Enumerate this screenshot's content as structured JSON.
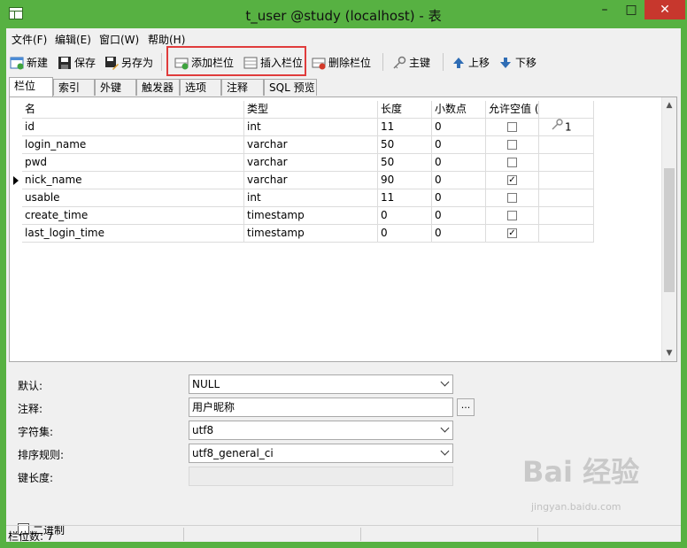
{
  "window": {
    "title": "t_user @study (localhost) - 表",
    "min_glyph": "–",
    "max_glyph": "□",
    "close_glyph": "✕"
  },
  "menubar": {
    "items": [
      {
        "label": "文件(F)"
      },
      {
        "label": "编辑(E)"
      },
      {
        "label": "窗口(W)"
      },
      {
        "label": "帮助(H)"
      }
    ]
  },
  "toolbar": {
    "new_label": "新建",
    "save_label": "保存",
    "save_as_label": "另存为",
    "add_field_label": "添加栏位",
    "insert_field_label": "插入栏位",
    "delete_field_label": "删除栏位",
    "primary_key_label": "主键",
    "move_up_label": "上移",
    "move_down_label": "下移"
  },
  "tabs": [
    {
      "label": "栏位"
    },
    {
      "label": "索引"
    },
    {
      "label": "外键"
    },
    {
      "label": "触发器"
    },
    {
      "label": "选项"
    },
    {
      "label": "注释"
    },
    {
      "label": "SQL 预览"
    }
  ],
  "grid": {
    "headers": {
      "name": "名",
      "type": "类型",
      "length": "长度",
      "decimals": "小数点",
      "nullable": "允许空值 ("
    },
    "rows": [
      {
        "name": "id",
        "type": "int",
        "length": "11",
        "decimals": "0",
        "nullable": false,
        "pk": "1"
      },
      {
        "name": "login_name",
        "type": "varchar",
        "length": "50",
        "decimals": "0",
        "nullable": false,
        "pk": ""
      },
      {
        "name": "pwd",
        "type": "varchar",
        "length": "50",
        "decimals": "0",
        "nullable": false,
        "pk": ""
      },
      {
        "name": "nick_name",
        "type": "varchar",
        "length": "90",
        "decimals": "0",
        "nullable": true,
        "pk": ""
      },
      {
        "name": "usable",
        "type": "int",
        "length": "11",
        "decimals": "0",
        "nullable": false,
        "pk": ""
      },
      {
        "name": "create_time",
        "type": "timestamp",
        "length": "0",
        "decimals": "0",
        "nullable": false,
        "pk": ""
      },
      {
        "name": "last_login_time",
        "type": "timestamp",
        "length": "0",
        "decimals": "0",
        "nullable": true,
        "pk": ""
      }
    ],
    "selected_row": 3
  },
  "properties": {
    "default_label": "默认:",
    "default_value": "NULL",
    "comment_label": "注释:",
    "comment_value": "用户昵称",
    "ellipsis_label": "...",
    "charset_label": "字符集:",
    "charset_value": "utf8",
    "collation_label": "排序规则:",
    "collation_value": "utf8_general_ci",
    "key_length_label": "键长度:",
    "key_length_value": "",
    "binary_label": "二进制"
  },
  "status": {
    "field_count": "栏位数: 7"
  },
  "watermark": {
    "brand": "Bai 经验",
    "url": "jingyan.baidu.com"
  },
  "colors": {
    "titlebar": "#57b142",
    "close": "#c7372d",
    "highlight_box": "#e03c3c"
  }
}
